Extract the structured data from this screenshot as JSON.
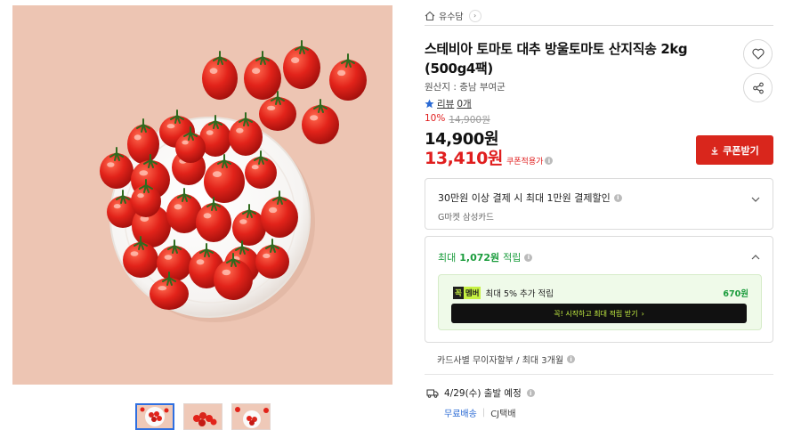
{
  "breadcrumb": {
    "label": "유수담"
  },
  "product": {
    "title": "스테비아 토마토 대추 방울토마토 산지직송 2kg (500g4팩)",
    "origin": "원산지 : 충남 부여군",
    "review_label": "리뷰",
    "review_count": "0개",
    "discount_rate": "10%",
    "original_price": "14,900원",
    "price": "14,900원",
    "coupon_price": "13,410원",
    "coupon_note": "쿠폰적용가"
  },
  "actions": {
    "coupon_button": "쿠폰받기"
  },
  "card_benefit": {
    "title": "30만원 이상 결제 시 최대 1만원 결제할인",
    "subtitle": "G마켓 삼성카드"
  },
  "reward": {
    "prefix": "최대",
    "amount": "1,072원",
    "suffix": "적립",
    "member_badge_1": "꼭",
    "member_badge_2": "멤버",
    "member_text": "최대 5% 추가 적립",
    "member_amount": "670원",
    "member_cta": "꼭! 시작하고 최대 적립 받기"
  },
  "installment": "카드사별 무이자할부 / 최대 3개월",
  "shipping": {
    "eta": "4/29(수) 출발 예정",
    "free": "무료배송",
    "carrier": "CJ택배"
  },
  "colors": {
    "accent_red": "#d9261c",
    "price_red": "#e01e1e",
    "reward_green": "#1a9c3c",
    "hero_bg": "#edc5b3"
  }
}
